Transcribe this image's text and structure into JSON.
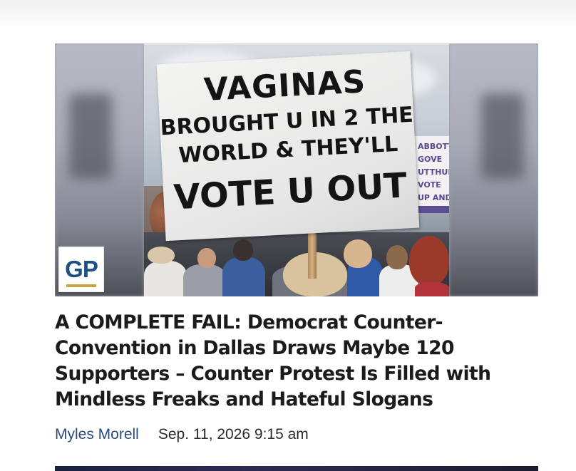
{
  "article": {
    "image": {
      "sign_main_lines": [
        "VAGINAS",
        "BROUGHT U IN 2 THE",
        "WORLD & THEY'LL",
        "VOTE U OUT"
      ],
      "sign_back_lines": [
        "ABBOTT",
        "GOVE",
        "UTTHUF",
        "VOTE",
        "UP AND D"
      ],
      "sign_back_color": "#5a4a8e"
    },
    "logo": {
      "text": "GP",
      "color": "#1f4f82",
      "accent": "#c9a33f"
    },
    "headline": "A COMPLETE FAIL: Democrat Counter-Convention in Dallas Draws Maybe 120 Supporters – Counter Protest Is Filled with Mindless Freaks and Hateful Slogans",
    "author": "Myles Morell",
    "date": "Sep. 11, 2026 9:15 am"
  },
  "colors": {
    "author": "#2b4c7e",
    "headline": "#1b1b1b"
  }
}
